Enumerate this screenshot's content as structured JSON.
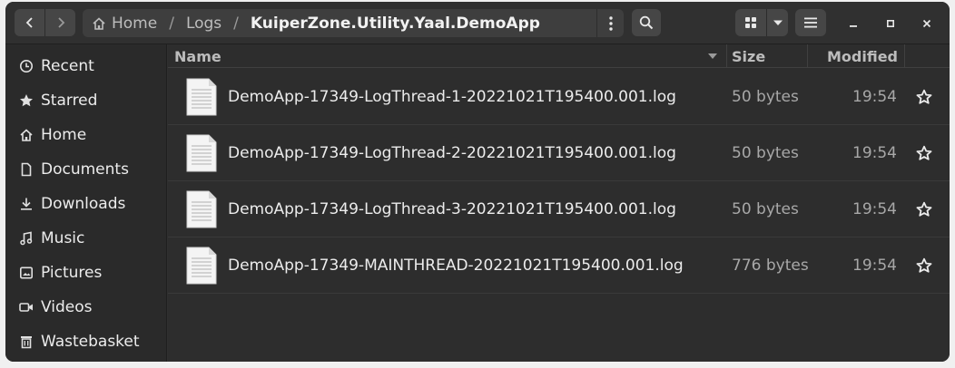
{
  "path": {
    "home": "Home",
    "crumbs": [
      "Logs"
    ],
    "current": "KuiperZone.Utility.Yaal.DemoApp"
  },
  "sidebar": {
    "items": [
      {
        "label": "Recent",
        "icon": "clock-icon"
      },
      {
        "label": "Starred",
        "icon": "star-icon"
      },
      {
        "label": "Home",
        "icon": "home-icon"
      },
      {
        "label": "Documents",
        "icon": "document-icon"
      },
      {
        "label": "Downloads",
        "icon": "download-icon"
      },
      {
        "label": "Music",
        "icon": "music-icon"
      },
      {
        "label": "Pictures",
        "icon": "picture-icon"
      },
      {
        "label": "Videos",
        "icon": "video-icon"
      },
      {
        "label": "Wastebasket",
        "icon": "trash-icon"
      }
    ]
  },
  "columns": {
    "name": "Name",
    "size": "Size",
    "modified": "Modified"
  },
  "files": [
    {
      "name": "DemoApp-17349-LogThread-1-20221021T195400.001.log",
      "size": "50 bytes",
      "modified": "19:54"
    },
    {
      "name": "DemoApp-17349-LogThread-2-20221021T195400.001.log",
      "size": "50 bytes",
      "modified": "19:54"
    },
    {
      "name": "DemoApp-17349-LogThread-3-20221021T195400.001.log",
      "size": "50 bytes",
      "modified": "19:54"
    },
    {
      "name": "DemoApp-17349-MAINTHREAD-20221021T195400.001.log",
      "size": "776 bytes",
      "modified": "19:54"
    }
  ],
  "colors": {
    "window_bg": "#303030",
    "sidebar_bg": "#2a2a2a",
    "content_bg": "#2d2d2d",
    "button_bg": "#464646",
    "text": "#ebebeb",
    "dim_text": "#a8a8a8"
  }
}
